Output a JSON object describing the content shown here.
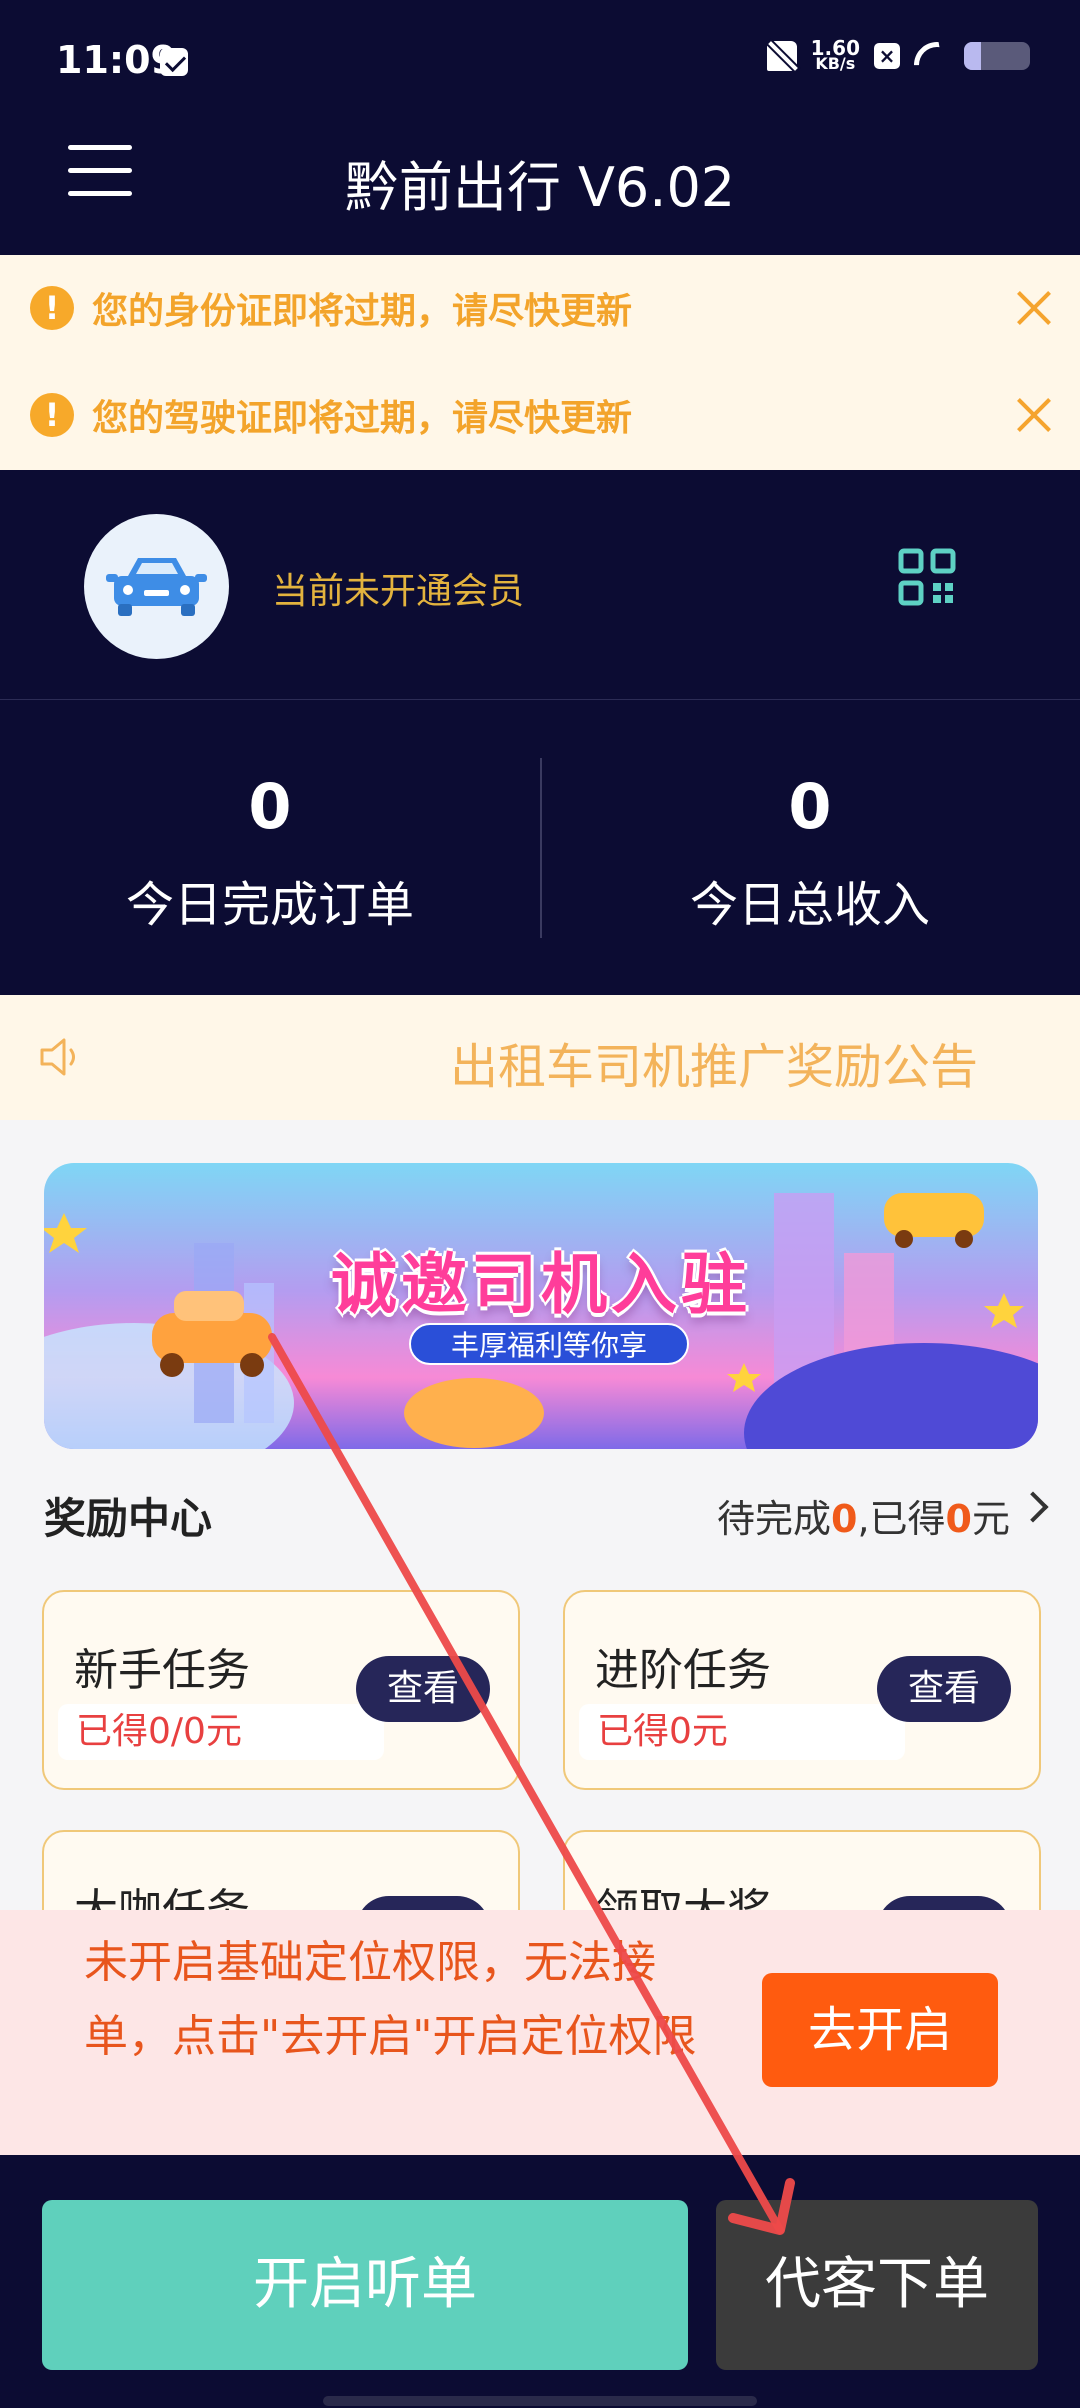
{
  "status_bar": {
    "time": "11:09",
    "net_speed_value": "1.60",
    "net_speed_unit": "KB/s",
    "battery_level": 0.25
  },
  "header": {
    "title": "黔前出行 V6.02"
  },
  "notices": [
    {
      "text": "您的身份证即将过期，请尽快更新"
    },
    {
      "text": "您的驾驶证即将过期，请尽快更新"
    }
  ],
  "profile": {
    "member_status": "当前未开通会员"
  },
  "stats": [
    {
      "value": "0",
      "label": "今日完成订单"
    },
    {
      "value": "0",
      "label": "今日总收入"
    }
  ],
  "announcement": {
    "text": "出租车司机推广奖励公告"
  },
  "banner": {
    "title": "诚邀司机入驻",
    "subtitle": "丰厚福利等你享"
  },
  "rewards": {
    "title": "奖励中心",
    "pending_prefix": "待完成",
    "pending_count": "0",
    "earned_prefix": ",已得",
    "earned_amount": "0",
    "earned_unit": "元"
  },
  "tasks": [
    {
      "name": "新手任务",
      "earned": "已得0/0元",
      "button": "查看"
    },
    {
      "name": "进阶任务",
      "earned": "已得0元",
      "button": "查看"
    },
    {
      "name": "大咖任务",
      "earned": "",
      "button": ""
    },
    {
      "name": "领取大奖",
      "earned": "",
      "button": ""
    }
  ],
  "permission": {
    "message": "未开启基础定位权限，无法接单，点击\"去开启\"开启定位权限",
    "button": "去开启"
  },
  "bottom": {
    "listen_button": "开启听单",
    "order_button": "代客下单"
  },
  "colors": {
    "navy": "#0c0c33",
    "notice_orange": "#f3a42b",
    "member_gold": "#e3b33e",
    "listen_teal": "#5fd0bc",
    "permission_orange": "#ff5b0f",
    "annotation_arrow": "#ee4a4a"
  }
}
